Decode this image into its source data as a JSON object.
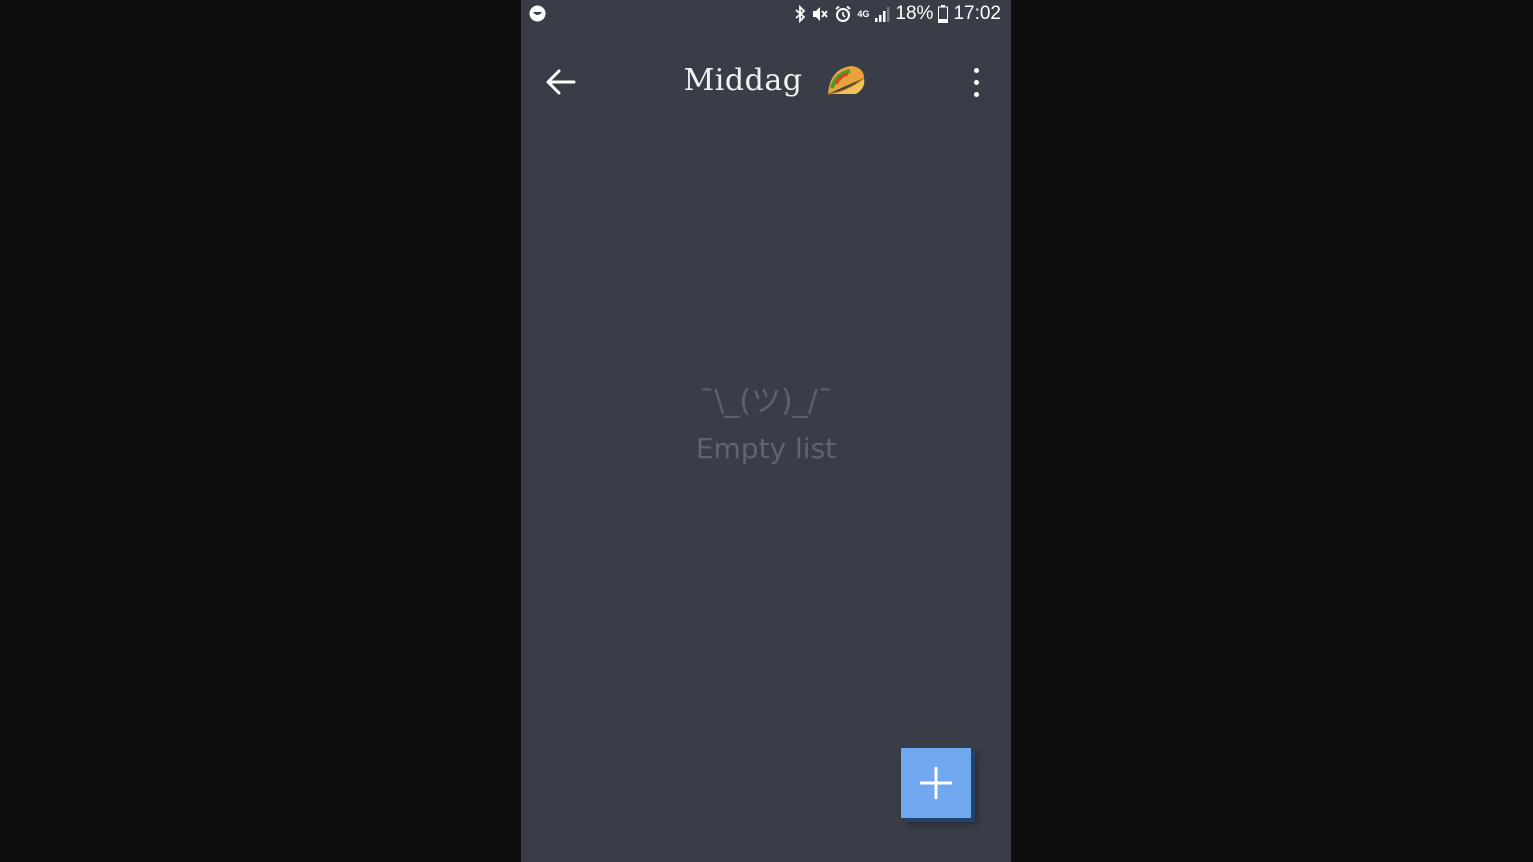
{
  "status_bar": {
    "battery_percent": "18%",
    "time": "17:02",
    "network": "4G",
    "icons": [
      "app-notification-icon",
      "bluetooth-icon",
      "mute-icon",
      "alarm-icon",
      "network-4g-icon",
      "signal-icon",
      "battery-icon"
    ]
  },
  "app_bar": {
    "title": "Middag",
    "title_icon": "taco-icon",
    "back_icon": "arrow-left-icon",
    "menu_icon": "more-vertical-icon"
  },
  "empty_state": {
    "emoticon": "¯\\_(ツ)_/¯",
    "message": "Empty list"
  },
  "fab": {
    "icon": "plus-icon",
    "color": "#6fa8ef"
  },
  "colors": {
    "background": "#393d48",
    "outer": "#0e0e0f",
    "text_muted": "#5f6471"
  }
}
